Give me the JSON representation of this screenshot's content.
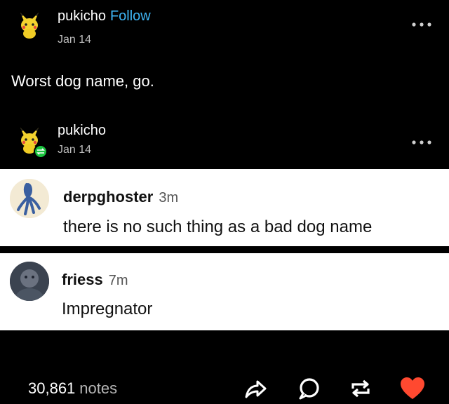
{
  "post": {
    "username": "pukicho",
    "follow_label": "Follow",
    "date": "Jan 14",
    "body": "Worst dog name, go."
  },
  "reblog": {
    "username": "pukicho",
    "date": "Jan 14"
  },
  "comments": [
    {
      "username": "derpghoster",
      "time": "3m",
      "text": "there is no such thing as a bad dog name"
    },
    {
      "username": "friess",
      "time": "7m",
      "text": "Impregnator"
    }
  ],
  "footer": {
    "notes_count": "30,861",
    "notes_label": "notes"
  },
  "icons": {
    "menu": "more-dots-icon",
    "share": "share-icon",
    "reply": "reply-icon",
    "reblog": "reblog-icon",
    "like": "heart-icon"
  },
  "colors": {
    "follow": "#3fb6f6",
    "heart": "#ff4930",
    "reblog_badge": "#1bc43f"
  }
}
